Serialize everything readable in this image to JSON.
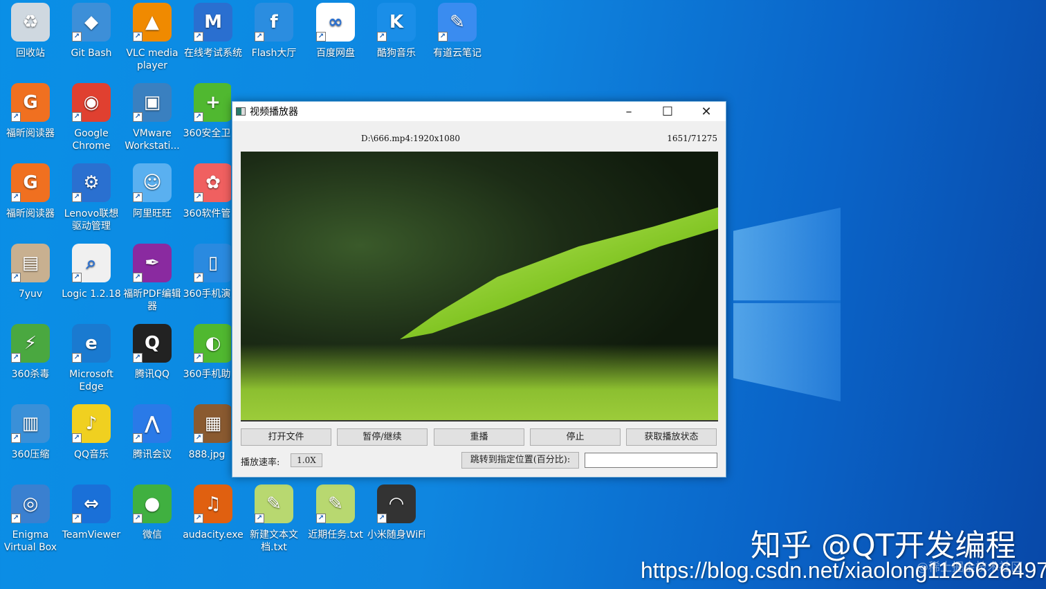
{
  "desktop": {
    "icons": [
      {
        "label": "回收站",
        "color": "#cfd8e0",
        "glyph": "♻",
        "col": 0,
        "row": 0,
        "shortcut": false
      },
      {
        "label": "Git Bash",
        "color": "#3d8fd8",
        "glyph": "◆",
        "col": 1,
        "row": 0
      },
      {
        "label": "VLC media player",
        "color": "#f08a00",
        "glyph": "▲",
        "col": 2,
        "row": 0
      },
      {
        "label": "在线考试系统",
        "color": "#2a6fd0",
        "glyph": "M",
        "col": 3,
        "row": 0
      },
      {
        "label": "Flash大厅",
        "color": "#2b8de0",
        "glyph": "f",
        "col": 4,
        "row": 0
      },
      {
        "label": "百度网盘",
        "color": "#ffffff",
        "glyph": "∞",
        "col": 5,
        "row": 0,
        "dark": true
      },
      {
        "label": "酷狗音乐",
        "color": "#1a8ee8",
        "glyph": "K",
        "col": 6,
        "row": 0
      },
      {
        "label": "有道云笔记",
        "color": "#3a8cf0",
        "glyph": "✎",
        "col": 7,
        "row": 0
      },
      {
        "label": "福昕阅读器",
        "color": "#f07020",
        "glyph": "G",
        "col": 0,
        "row": 1
      },
      {
        "label": "Google Chrome",
        "color": "#e04030",
        "glyph": "◉",
        "col": 1,
        "row": 1
      },
      {
        "label": "VMware Workstati...",
        "color": "#3a80c0",
        "glyph": "▣",
        "col": 2,
        "row": 1
      },
      {
        "label": "360安全卫",
        "color": "#50b830",
        "glyph": "+",
        "col": 3,
        "row": 1
      },
      {
        "label": "福昕阅读器",
        "color": "#f07020",
        "glyph": "G",
        "col": 0,
        "row": 2
      },
      {
        "label": "Lenovo联想驱动管理",
        "color": "#2a70d0",
        "glyph": "⚙",
        "col": 1,
        "row": 2
      },
      {
        "label": "阿里旺旺",
        "color": "#5ab0f0",
        "glyph": "☺",
        "col": 2,
        "row": 2
      },
      {
        "label": "360软件管",
        "color": "#f06060",
        "glyph": "✿",
        "col": 3,
        "row": 2
      },
      {
        "label": "7yuv",
        "color": "#c8b090",
        "glyph": "▤",
        "col": 0,
        "row": 3
      },
      {
        "label": "Logic 1.2.18",
        "color": "#f0f0f0",
        "glyph": "⌕",
        "col": 1,
        "row": 3,
        "dark": true
      },
      {
        "label": "福昕PDF编辑器",
        "color": "#8a2aa0",
        "glyph": "✒",
        "col": 2,
        "row": 3
      },
      {
        "label": "360手机演",
        "color": "#2a8ae0",
        "glyph": "▯",
        "col": 3,
        "row": 3
      },
      {
        "label": "360杀毒",
        "color": "#4aa840",
        "glyph": "⚡",
        "col": 0,
        "row": 4
      },
      {
        "label": "Microsoft Edge",
        "color": "#1a7ad0",
        "glyph": "e",
        "col": 1,
        "row": 4
      },
      {
        "label": "腾讯QQ",
        "color": "#222222",
        "glyph": "Q",
        "col": 2,
        "row": 4
      },
      {
        "label": "360手机助",
        "color": "#50b830",
        "glyph": "◐",
        "col": 3,
        "row": 4
      },
      {
        "label": "360压缩",
        "color": "#3a90d8",
        "glyph": "▥",
        "col": 0,
        "row": 5
      },
      {
        "label": "QQ音乐",
        "color": "#f0d020",
        "glyph": "♪",
        "col": 1,
        "row": 5
      },
      {
        "label": "腾讯会议",
        "color": "#2a7ae8",
        "glyph": "⋀",
        "col": 2,
        "row": 5
      },
      {
        "label": "888.jpg",
        "color": "#8a5a30",
        "glyph": "▦",
        "col": 3,
        "row": 5
      },
      {
        "label": "Enigma Virtual Box",
        "color": "#3a80d0",
        "glyph": "◎",
        "col": 0,
        "row": 6
      },
      {
        "label": "TeamViewer",
        "color": "#1a70d8",
        "glyph": "⇔",
        "col": 1,
        "row": 6
      },
      {
        "label": "微信",
        "color": "#40b040",
        "glyph": "●",
        "col": 2,
        "row": 6
      },
      {
        "label": "audacity.exe",
        "color": "#e06010",
        "glyph": "♫",
        "col": 3,
        "row": 6
      },
      {
        "label": "新建文本文档.txt",
        "color": "#b8d870",
        "glyph": "✎",
        "col": 4,
        "row": 6
      },
      {
        "label": "近期任务.txt",
        "color": "#b8d870",
        "glyph": "✎",
        "col": 5,
        "row": 6
      },
      {
        "label": "小米随身WiFi",
        "color": "#333333",
        "glyph": "◠",
        "col": 6,
        "row": 6
      }
    ]
  },
  "window": {
    "title": "视频播放器",
    "file_info": "D:\\666.mp4:1920x1080",
    "frame_counter": "1651/71275",
    "buttons": [
      "打开文件",
      "暂停/继续",
      "重播",
      "停止",
      "获取播放状态"
    ],
    "speed_label": "播放速率:",
    "speed_value": "1.0X",
    "seek_button": "跳转到指定位置(百分比):",
    "seek_value": ""
  },
  "watermark": {
    "zhihu": "知乎 @QT开发编程",
    "url": "https://blog.csdn.net/xiaolong1126626497",
    "juejin": "@稀土掘金技术社区"
  }
}
